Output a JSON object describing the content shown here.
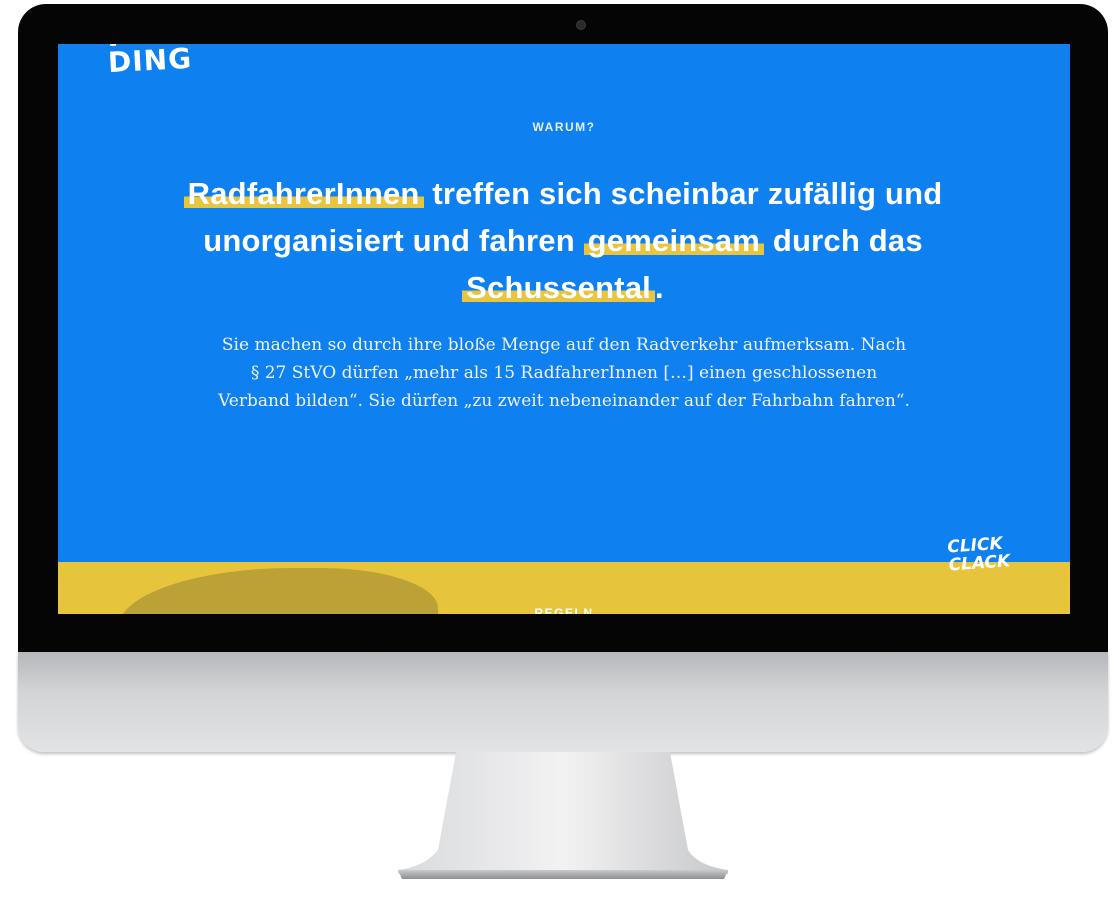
{
  "site": {
    "logo_fragment": "DING",
    "section": {
      "eyebrow": "WARUM?",
      "headline": {
        "h1": "RadfahrerInnen",
        "t1": " treffen sich scheinbar zufällig und unorganisiert und fahren ",
        "h2": "gemeinsam",
        "t2": " durch das ",
        "h3": "Schussental",
        "t3": "."
      },
      "body": "Sie machen so durch ihre bloße Menge auf den Radverkehr auf­merksam. Nach § 27 StVO dürfen „mehr als 15 RadfahrerInnen […] einen geschlossenen Verband bilden“. Sie dürfen „zu zweit neben­einander auf der Fahrbahn fahren“."
    },
    "corner_logo": "CLICK CLACK",
    "next_section_label": "REGELN"
  },
  "colors": {
    "screen_background": "#0e80f0",
    "highlight": "#e8c43f",
    "yellow_band": "#e6c53c",
    "bezel": "#050505"
  }
}
